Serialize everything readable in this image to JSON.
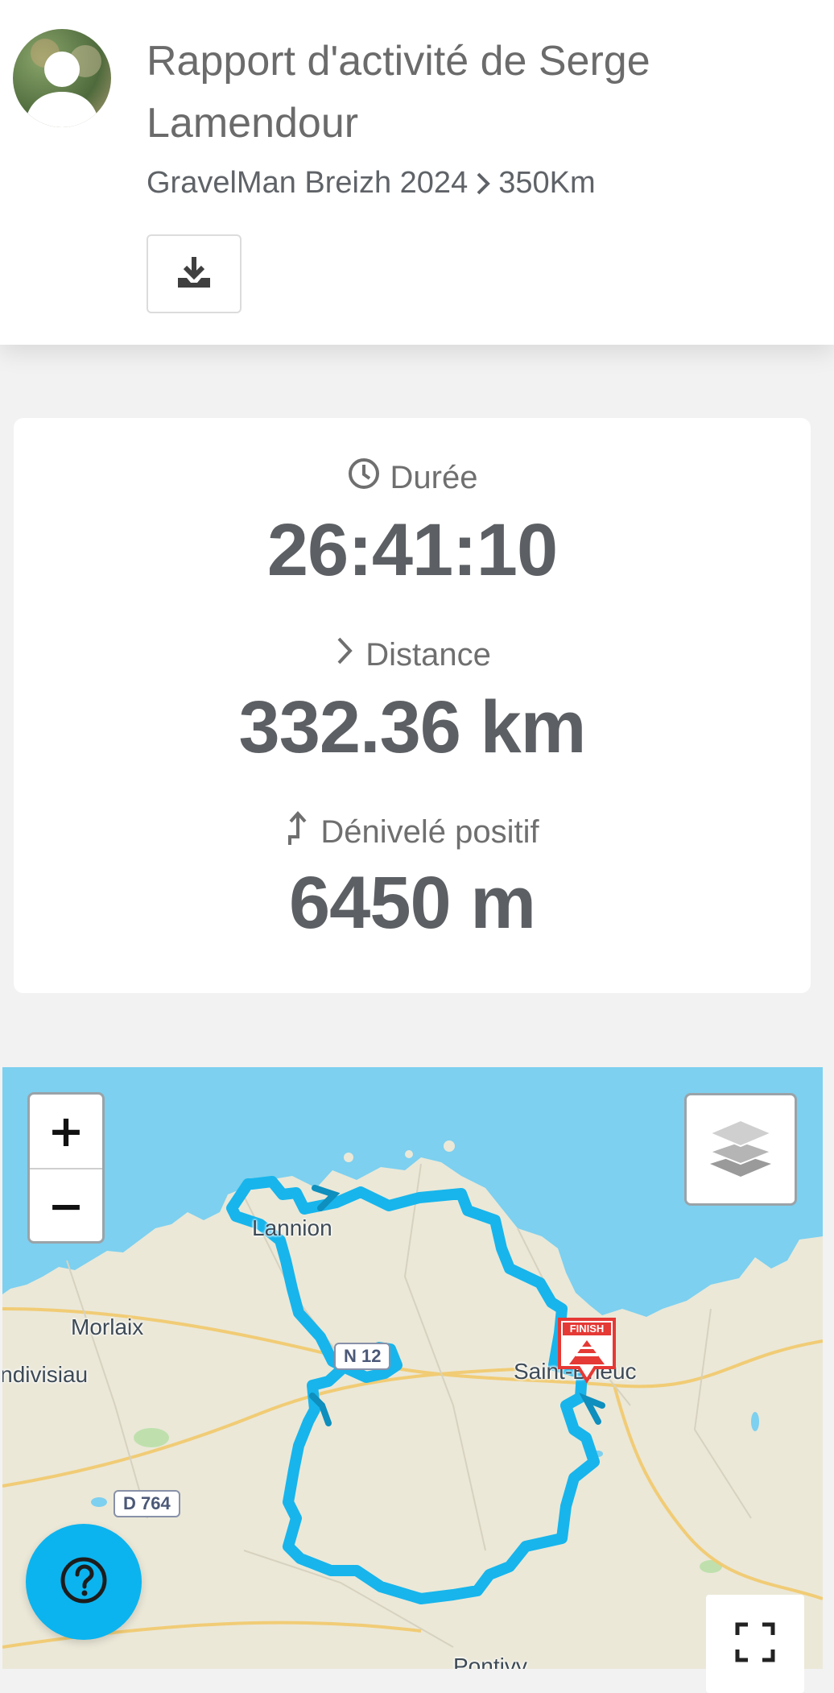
{
  "header": {
    "title": "Rapport d'activité de Serge Lamendour",
    "event": "GravelMan Breizh 2024",
    "course": "350Km",
    "download_icon": "download-icon",
    "avatar_icon": "user-avatar"
  },
  "stats": {
    "duration_label": "Durée",
    "duration_value": "26:41:10",
    "distance_label": "Distance",
    "distance_value": "332.36 km",
    "elevation_label": "Dénivelé positif",
    "elevation_value": "6450 m",
    "icons": [
      "clock-icon",
      "chevron-right-icon",
      "arrow-up-icon"
    ]
  },
  "map": {
    "zoom_in": "+",
    "zoom_out": "−",
    "labels": {
      "lannion": "Lannion",
      "morlaix": "Morlaix",
      "landivisiau": "Landivisiau",
      "saint_brieuc": "Saint-Brieuc",
      "pontivy": "Pontivy"
    },
    "roads": {
      "n12": "N 12",
      "d764": "D 764"
    },
    "finish_marker": "FINISH",
    "colors": {
      "sea": "#7dd0ef",
      "land": "#ebe8d8",
      "route": "#17b5ec",
      "route_arrow": "#0e8fbd",
      "finish": "#e53935"
    },
    "controls": [
      "layers-icon",
      "fullscreen-icon",
      "help-icon"
    ]
  }
}
